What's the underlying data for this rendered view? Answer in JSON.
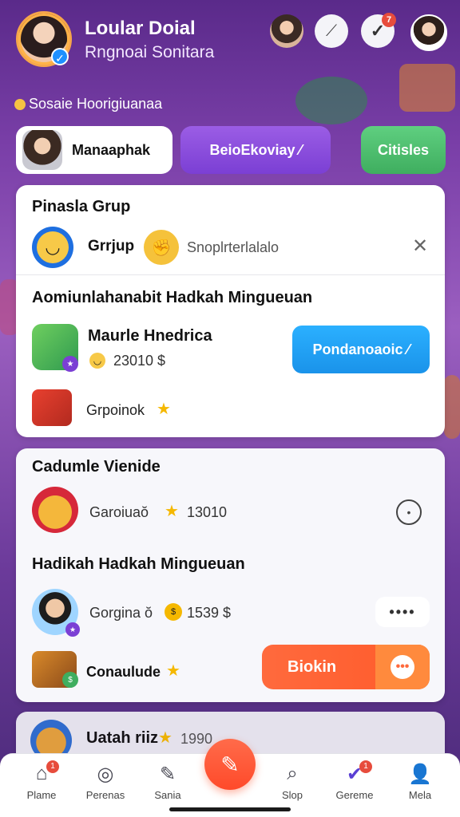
{
  "header": {
    "title": "Loular Doial",
    "subtitle": "Rngnoai Sonitara",
    "badge_count": "7"
  },
  "section_label": "Sosaie Hoorigiuanaa",
  "pills": {
    "profile_label": "Manaaphak",
    "purple_label": "BeioEkoviay ⁄",
    "green_label": "Citisles"
  },
  "card1": {
    "title": "Pinasla Grup",
    "group_label": "Grrjup",
    "group_detail": "Snoplrterlalalo",
    "subtitle": "Aomiunlahanabit Hadkah Mingueuan",
    "item_title": "Maurle Hnedrica",
    "item_value": "23010 $",
    "action_label": "Pondanoaoic ⁄",
    "reward_label": "Grpoinok"
  },
  "card2": {
    "title": "Cadumle Vienide",
    "row1_name": "Garoiuaŏ",
    "row1_value": "13010",
    "subtitle": "Hadikah Hadkah Mingueuan",
    "row2_name": "Gorgina ŏ",
    "row2_value": "1539 $",
    "more_label": "••••",
    "reward_label": "Conaulude",
    "button_label": "Biokin"
  },
  "card3": {
    "name": "Uatah riiz",
    "value": "1990"
  },
  "bottom_nav": [
    {
      "label": "Plame",
      "icon": "home-icon",
      "badge": "1"
    },
    {
      "label": "Perenas",
      "icon": "compass-icon"
    },
    {
      "label": "Sania",
      "icon": "edit-icon"
    },
    {
      "label": "Slop",
      "icon": "search-icon"
    },
    {
      "label": "Gereme",
      "icon": "check-circle-icon",
      "badge": "1"
    },
    {
      "label": "Mela",
      "icon": "user-icon"
    }
  ],
  "colors": {
    "accent_purple": "#7b3fd4",
    "accent_green": "#3fae5f",
    "accent_blue": "#1a93ea",
    "accent_orange": "#ff5a2a"
  }
}
